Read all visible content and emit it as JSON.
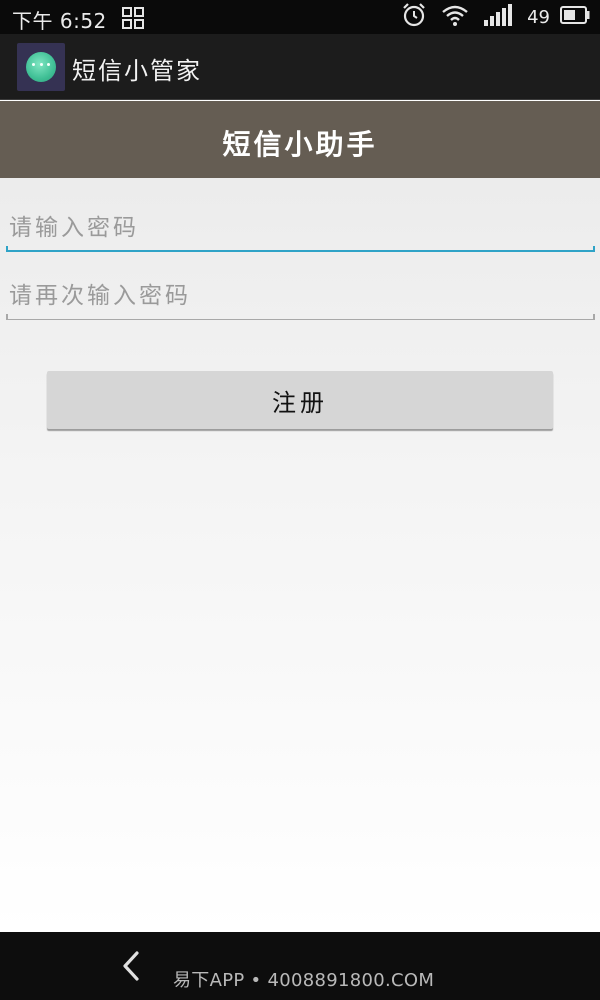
{
  "status_bar": {
    "time": "下午 6:52",
    "battery_level": "49",
    "icons": [
      "grid-icon",
      "alarm-clock-icon",
      "wifi-icon",
      "signal-icon",
      "battery-icon"
    ]
  },
  "action_bar": {
    "app_title": "短信小管家",
    "app_icon": "chat-bubble-icon"
  },
  "header": {
    "title": "短信小助手"
  },
  "form": {
    "password_placeholder": "请输入密码",
    "password_value": "",
    "confirm_placeholder": "请再次输入密码",
    "confirm_value": "",
    "register_label": "注册"
  },
  "nav_bar": {
    "back_icon": "chevron-left-icon",
    "watermark": "易下APP • 4008891800.COM"
  },
  "colors": {
    "status_bar_bg": "#0a0a0a",
    "action_bar_bg": "#1c1c1c",
    "header_bg": "#655d53",
    "focused_underline": "#2fa3c7",
    "button_bg": "#d6d6d6",
    "nav_bar_bg": "#0d0d0d"
  }
}
